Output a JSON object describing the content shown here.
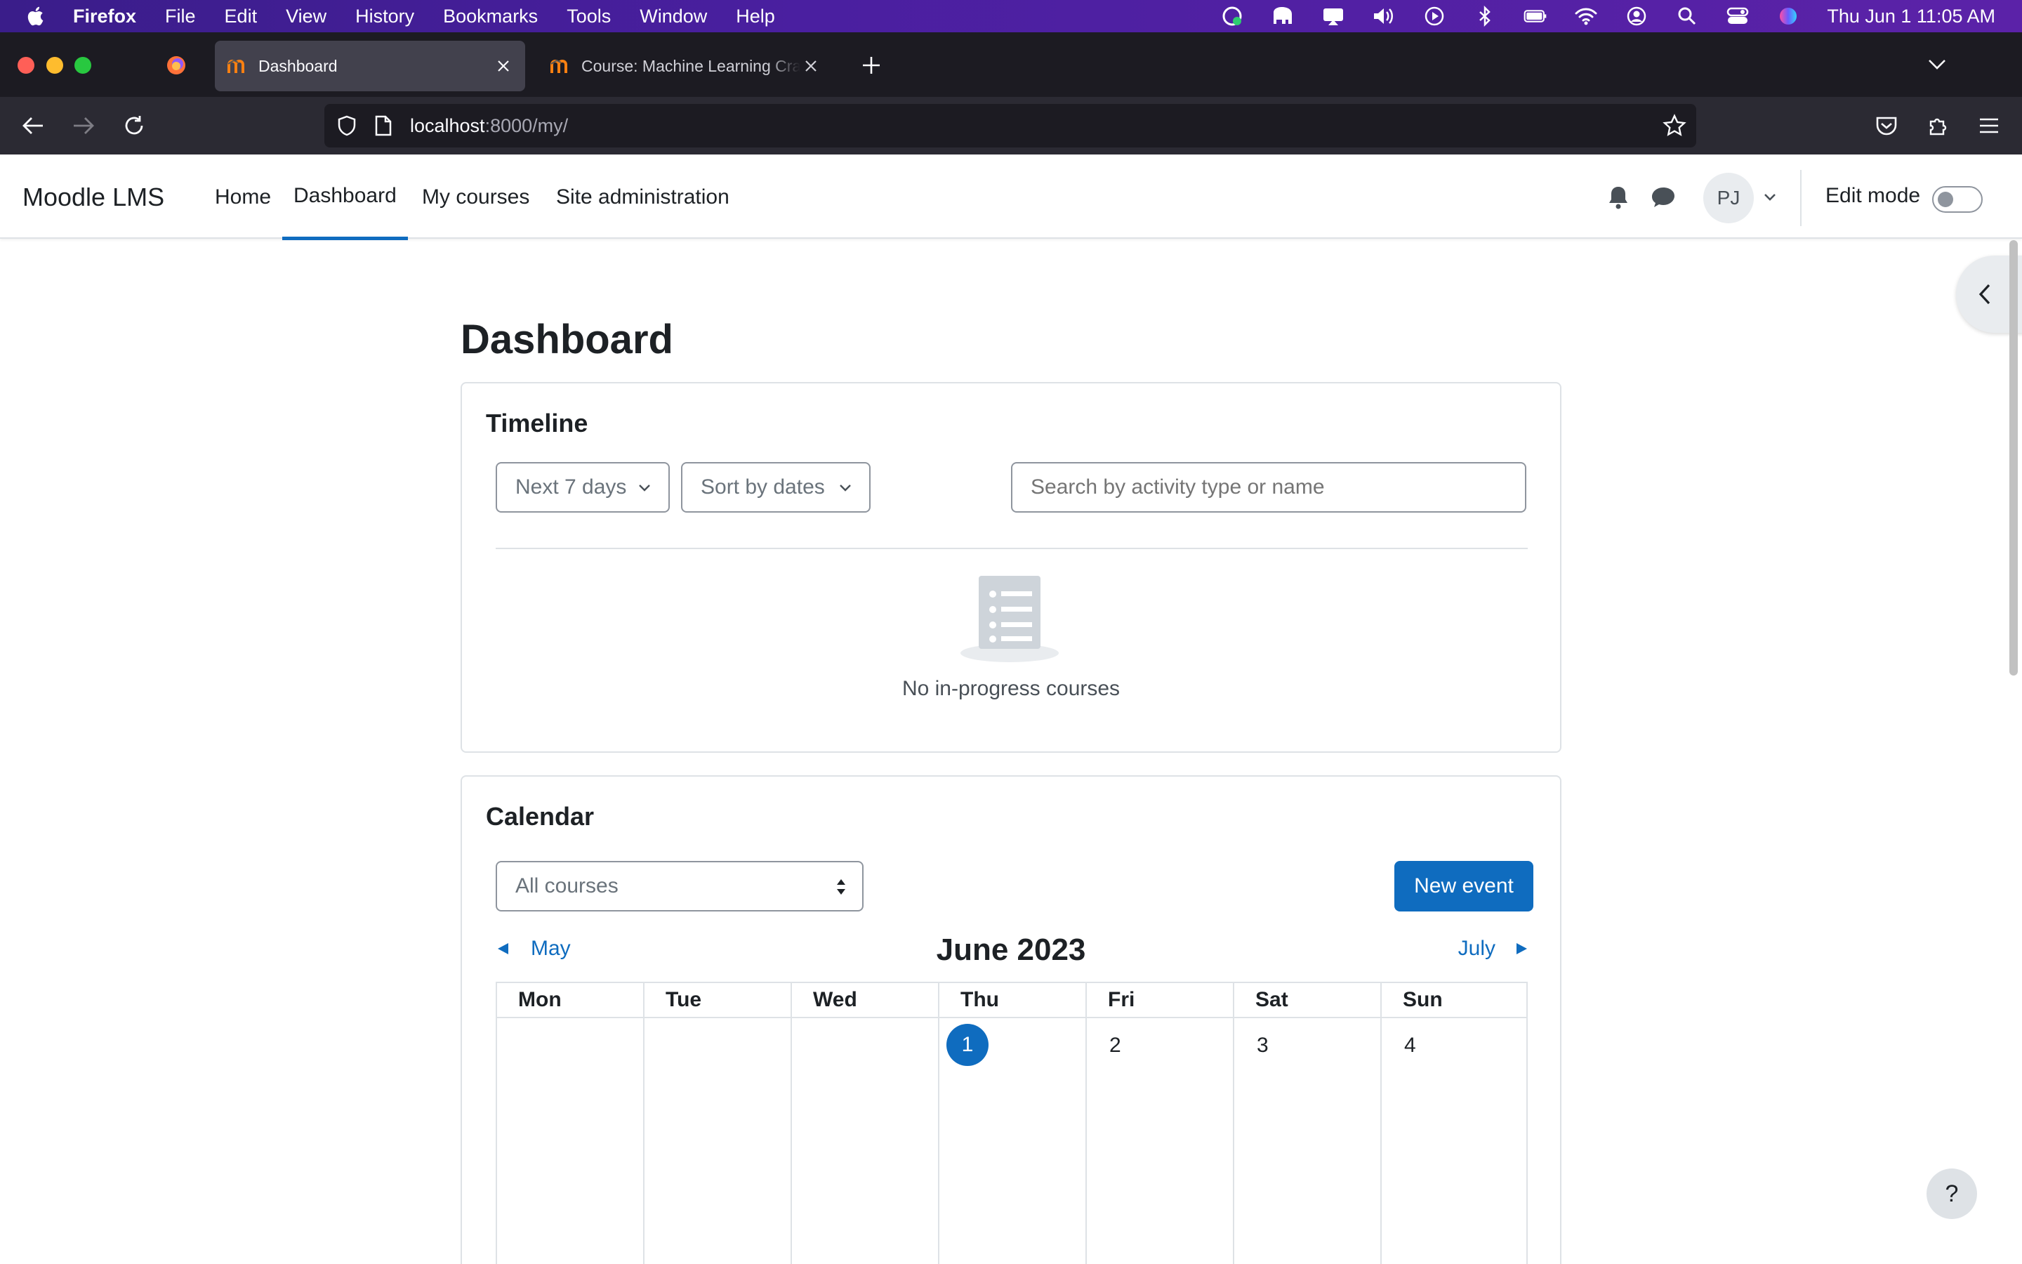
{
  "menubar": {
    "app_name": "Firefox",
    "items": [
      "File",
      "Edit",
      "View",
      "History",
      "Bookmarks",
      "Tools",
      "Window",
      "Help"
    ],
    "clock": "Thu Jun 1  11:05 AM"
  },
  "browser": {
    "tabs": [
      {
        "title": "Dashboard",
        "active": true
      },
      {
        "title": "Course: Machine Learning Crash Course",
        "active": false
      }
    ],
    "url_host": "localhost",
    "url_rest": ":8000/my/"
  },
  "moodle": {
    "brand": "Moodle LMS",
    "nav": [
      "Home",
      "Dashboard",
      "My courses",
      "Site administration"
    ],
    "active_nav": "Dashboard",
    "avatar_initials": "PJ",
    "edit_mode_label": "Edit mode",
    "edit_mode_on": false
  },
  "page": {
    "title": "Dashboard"
  },
  "timeline": {
    "title": "Timeline",
    "filter_label": "Next 7 days",
    "sort_label": "Sort by dates",
    "search_placeholder": "Search by activity type or name",
    "empty_message": "No in-progress courses"
  },
  "calendar": {
    "title": "Calendar",
    "course_filter": "All courses",
    "new_event_label": "New event",
    "prev_month": "May",
    "next_month": "July",
    "month_title": "June 2023",
    "weekdays": [
      "Mon",
      "Tue",
      "Wed",
      "Thu",
      "Fri",
      "Sat",
      "Sun"
    ],
    "first_week": [
      "",
      "",
      "",
      "1",
      "2",
      "3",
      "4"
    ],
    "today": "1"
  },
  "help_label": "?",
  "colors": {
    "accent": "#0f6cbf",
    "menubar": "#4a1fa0",
    "browser_chrome": "#1c1b22"
  }
}
